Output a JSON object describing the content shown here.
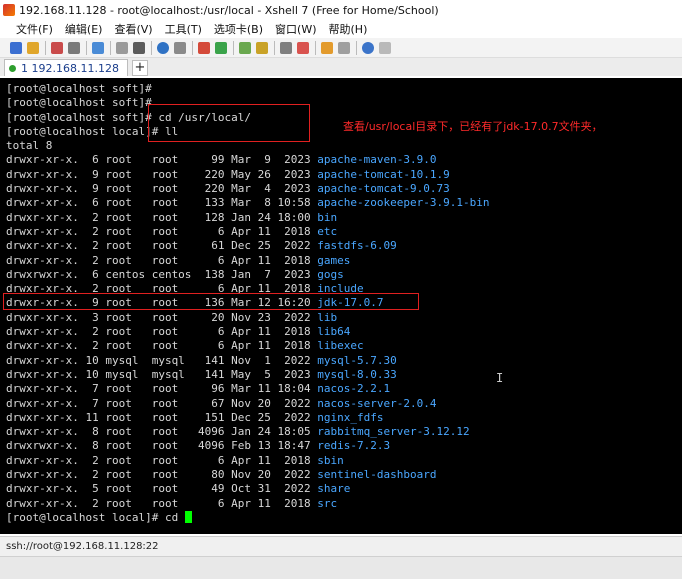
{
  "window": {
    "title": "192.168.11.128 - root@localhost:/usr/local - Xshell 7 (Free for Home/School)"
  },
  "menu": [
    "文件(F)",
    "编辑(E)",
    "查看(V)",
    "工具(T)",
    "选项卡(B)",
    "窗口(W)",
    "帮助(H)"
  ],
  "tab": {
    "label": "1 192.168.11.128",
    "add": "+"
  },
  "terminal": {
    "prompt_lines": [
      "[root@localhost soft]#",
      "[root@localhost soft]#",
      "[root@localhost soft]# cd /usr/local/",
      "[root@localhost local]# ll"
    ],
    "total": "total 8",
    "listing": [
      {
        "meta": "drwxr-xr-x.  6 root   root     99 Mar  9  2023",
        "name": "apache-maven-3.9.0"
      },
      {
        "meta": "drwxr-xr-x.  9 root   root    220 May 26  2023",
        "name": "apache-tomcat-10.1.9"
      },
      {
        "meta": "drwxr-xr-x.  9 root   root    220 Mar  4  2023",
        "name": "apache-tomcat-9.0.73"
      },
      {
        "meta": "drwxr-xr-x.  6 root   root    133 Mar  8 10:58",
        "name": "apache-zookeeper-3.9.1-bin"
      },
      {
        "meta": "drwxr-xr-x.  2 root   root    128 Jan 24 18:00",
        "name": "bin"
      },
      {
        "meta": "drwxr-xr-x.  2 root   root      6 Apr 11  2018",
        "name": "etc"
      },
      {
        "meta": "drwxr-xr-x.  2 root   root     61 Dec 25  2022",
        "name": "fastdfs-6.09"
      },
      {
        "meta": "drwxr-xr-x.  2 root   root      6 Apr 11  2018",
        "name": "games"
      },
      {
        "meta": "drwxrwxr-x.  6 centos centos  138 Jan  7  2023",
        "name": "gogs"
      },
      {
        "meta": "drwxr-xr-x.  2 root   root      6 Apr 11  2018",
        "name": "include"
      },
      {
        "meta": "drwxr-xr-x.  9 root   root    136 Mar 12 16:20",
        "name": "jdk-17.0.7"
      },
      {
        "meta": "drwxr-xr-x.  3 root   root     20 Nov 23  2022",
        "name": "lib"
      },
      {
        "meta": "drwxr-xr-x.  2 root   root      6 Apr 11  2018",
        "name": "lib64"
      },
      {
        "meta": "drwxr-xr-x.  2 root   root      6 Apr 11  2018",
        "name": "libexec"
      },
      {
        "meta": "drwxr-xr-x. 10 mysql  mysql   141 Nov  1  2022",
        "name": "mysql-5.7.30"
      },
      {
        "meta": "drwxr-xr-x. 10 mysql  mysql   141 May  5  2023",
        "name": "mysql-8.0.33"
      },
      {
        "meta": "drwxr-xr-x.  7 root   root     96 Mar 11 18:04",
        "name": "nacos-2.2.1"
      },
      {
        "meta": "drwxr-xr-x.  7 root   root     67 Nov 20  2022",
        "name": "nacos-server-2.0.4"
      },
      {
        "meta": "drwxr-xr-x. 11 root   root    151 Dec 25  2022",
        "name": "nginx_fdfs"
      },
      {
        "meta": "drwxr-xr-x.  8 root   root   4096 Jan 24 18:05",
        "name": "rabbitmq_server-3.12.12"
      },
      {
        "meta": "drwxrwxr-x.  8 root   root   4096 Feb 13 18:47",
        "name": "redis-7.2.3"
      },
      {
        "meta": "drwxr-xr-x.  2 root   root      6 Apr 11  2018",
        "name": "sbin"
      },
      {
        "meta": "drwxr-xr-x.  2 root   root     80 Nov 20  2022",
        "name": "sentinel-dashboard"
      },
      {
        "meta": "drwxr-xr-x.  5 root   root     49 Oct 31  2022",
        "name": "share"
      },
      {
        "meta": "drwxr-xr-x.  2 root   root      6 Apr 11  2018",
        "name": "src"
      }
    ],
    "final_prompt": "[root@localhost local]# cd ",
    "dir_color": "#4aa7ff",
    "cursor_color": "#00ff00"
  },
  "annotation": {
    "text": "查看/usr/local目录下，已经有了jdk-17.0.7文件夹，",
    "color": "#ff2a2a"
  },
  "status": {
    "text": "ssh://root@192.168.11.128:22"
  }
}
